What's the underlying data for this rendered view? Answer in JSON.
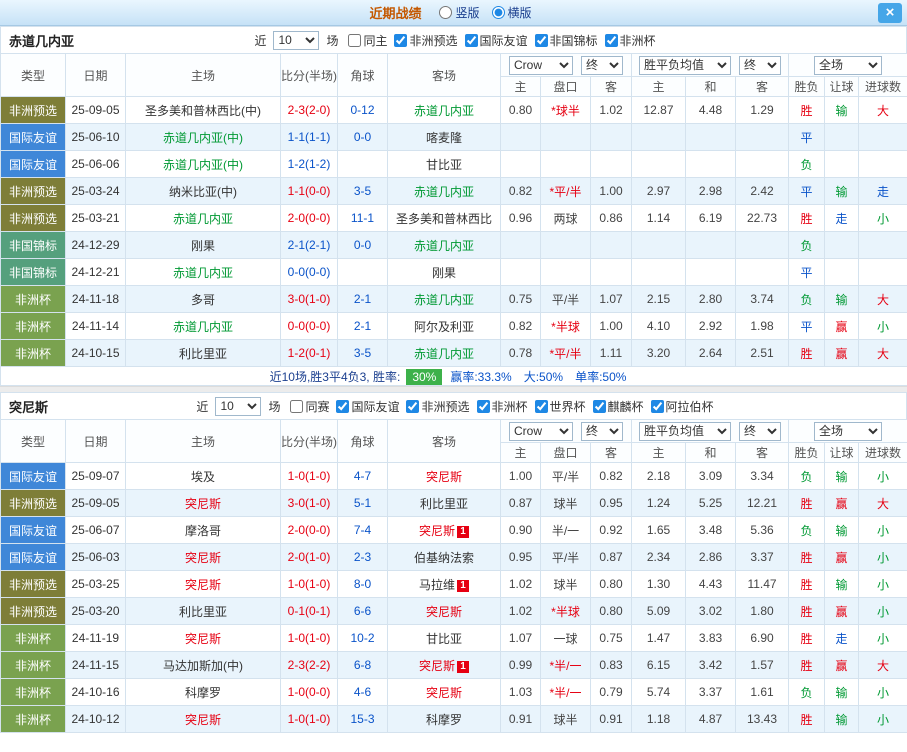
{
  "title_bar": {
    "title": "近期战绩",
    "vertical": "竖版",
    "horizontal": "横版",
    "close": "×"
  },
  "labels": {
    "near": "近",
    "games": "场"
  },
  "table_head": {
    "main": [
      "类型",
      "日期",
      "主场",
      "比分(半场)",
      "角球",
      "客场"
    ],
    "sub": [
      "主",
      "盘口",
      "客",
      "主",
      "和",
      "客",
      "胜负",
      "让球",
      "进球数"
    ]
  },
  "colors": {
    "red": "#e60012",
    "green": "#009933",
    "blue": "#0a53c9",
    "win_rate_badge": "#3db14a",
    "type": {
      "非洲预选": "#7e7e38",
      "国际友谊": "#3f87d8",
      "非国锦标": "#55a07d",
      "非洲杯": "#7aa24f"
    }
  },
  "sections": [
    {
      "team": "赤道几内亚",
      "focal_color": "#009933",
      "selects": {
        "count": "10",
        "book": "Crow",
        "book_state": "终",
        "avg": "胜平负均值",
        "avg_state": "终",
        "scope": "全场"
      },
      "filters": [
        {
          "label": "同主",
          "on": false
        },
        {
          "label": "非洲预选",
          "on": true
        },
        {
          "label": "国际友谊",
          "on": true
        },
        {
          "label": "非国锦标",
          "on": true
        },
        {
          "label": "非洲杯",
          "on": true
        }
      ],
      "rows": [
        {
          "ty": "非洲预选",
          "dt": "25-09-05",
          "hm": "圣多美和普林西比(中)",
          "hf": 0,
          "hr": 0,
          "sc": "2-3(2-0)",
          "sx": "r",
          "cn": "0-12",
          "aw": "赤道几内亚",
          "af": 1,
          "ar": 0,
          "od": [
            "0.80",
            "*球半",
            "1.02"
          ],
          "ox": "r",
          "av": [
            "12.87",
            "4.48",
            "1.29"
          ],
          "rs": [
            "胜",
            "r"
          ],
          "rq": [
            "输",
            "g"
          ],
          "gq": [
            "大",
            "r"
          ]
        },
        {
          "ty": "国际友谊",
          "dt": "25-06-10",
          "hm": "赤道几内亚(中)",
          "hf": 1,
          "hr": 0,
          "sc": "1-1(1-1)",
          "sx": "b",
          "cn": "0-0",
          "aw": "喀麦隆",
          "af": 0,
          "ar": 0,
          "od": [
            "",
            "",
            ""
          ],
          "ox": "",
          "av": [
            "",
            "",
            ""
          ],
          "rs": [
            "平",
            "b"
          ],
          "rq": [
            "",
            ""
          ],
          "gq": [
            "",
            ""
          ]
        },
        {
          "ty": "国际友谊",
          "dt": "25-06-06",
          "hm": "赤道几内亚(中)",
          "hf": 1,
          "hr": 0,
          "sc": "1-2(1-2)",
          "sx": "b",
          "cn": "",
          "aw": "甘比亚",
          "af": 0,
          "ar": 0,
          "od": [
            "",
            "",
            ""
          ],
          "ox": "",
          "av": [
            "",
            "",
            ""
          ],
          "rs": [
            "负",
            "g"
          ],
          "rq": [
            "",
            ""
          ],
          "gq": [
            "",
            ""
          ]
        },
        {
          "ty": "非洲预选",
          "dt": "25-03-24",
          "hm": "纳米比亚(中)",
          "hf": 0,
          "hr": 0,
          "sc": "1-1(0-0)",
          "sx": "r",
          "cn": "3-5",
          "aw": "赤道几内亚",
          "af": 1,
          "ar": 0,
          "od": [
            "0.82",
            "*平/半",
            "1.00"
          ],
          "ox": "r",
          "av": [
            "2.97",
            "2.98",
            "2.42"
          ],
          "rs": [
            "平",
            "b"
          ],
          "rq": [
            "输",
            "g"
          ],
          "gq": [
            "走",
            "b"
          ]
        },
        {
          "ty": "非洲预选",
          "dt": "25-03-21",
          "hm": "赤道几内亚",
          "hf": 1,
          "hr": 0,
          "sc": "2-0(0-0)",
          "sx": "r",
          "cn": "11-1",
          "aw": "圣多美和普林西比",
          "af": 0,
          "ar": 0,
          "od": [
            "0.96",
            "两球",
            "0.86"
          ],
          "ox": "",
          "av": [
            "1.14",
            "6.19",
            "22.73"
          ],
          "rs": [
            "胜",
            "r"
          ],
          "rq": [
            "走",
            "b"
          ],
          "gq": [
            "小",
            "g"
          ]
        },
        {
          "ty": "非国锦标",
          "dt": "24-12-29",
          "hm": "刚果",
          "hf": 0,
          "hr": 0,
          "sc": "2-1(2-1)",
          "sx": "b",
          "cn": "0-0",
          "aw": "赤道几内亚",
          "af": 1,
          "ar": 0,
          "od": [
            "",
            "",
            ""
          ],
          "ox": "",
          "av": [
            "",
            "",
            ""
          ],
          "rs": [
            "负",
            "g"
          ],
          "rq": [
            "",
            ""
          ],
          "gq": [
            "",
            ""
          ]
        },
        {
          "ty": "非国锦标",
          "dt": "24-12-21",
          "hm": "赤道几内亚",
          "hf": 1,
          "hr": 0,
          "sc": "0-0(0-0)",
          "sx": "b",
          "cn": "",
          "aw": "刚果",
          "af": 0,
          "ar": 0,
          "od": [
            "",
            "",
            ""
          ],
          "ox": "",
          "av": [
            "",
            "",
            ""
          ],
          "rs": [
            "平",
            "b"
          ],
          "rq": [
            "",
            ""
          ],
          "gq": [
            "",
            ""
          ]
        },
        {
          "ty": "非洲杯",
          "dt": "24-11-18",
          "hm": "多哥",
          "hf": 0,
          "hr": 0,
          "sc": "3-0(1-0)",
          "sx": "r",
          "cn": "2-1",
          "aw": "赤道几内亚",
          "af": 1,
          "ar": 0,
          "od": [
            "0.75",
            "平/半",
            "1.07"
          ],
          "ox": "",
          "av": [
            "2.15",
            "2.80",
            "3.74"
          ],
          "rs": [
            "负",
            "g"
          ],
          "rq": [
            "输",
            "g"
          ],
          "gq": [
            "大",
            "r"
          ]
        },
        {
          "ty": "非洲杯",
          "dt": "24-11-14",
          "hm": "赤道几内亚",
          "hf": 1,
          "hr": 0,
          "sc": "0-0(0-0)",
          "sx": "r",
          "cn": "2-1",
          "aw": "阿尔及利亚",
          "af": 0,
          "ar": 0,
          "od": [
            "0.82",
            "*半球",
            "1.00"
          ],
          "ox": "r",
          "av": [
            "4.10",
            "2.92",
            "1.98"
          ],
          "rs": [
            "平",
            "b"
          ],
          "rq": [
            "赢",
            "r"
          ],
          "gq": [
            "小",
            "g"
          ]
        },
        {
          "ty": "非洲杯",
          "dt": "24-10-15",
          "hm": "利比里亚",
          "hf": 0,
          "hr": 0,
          "sc": "1-2(0-1)",
          "sx": "r",
          "cn": "3-5",
          "aw": "赤道几内亚",
          "af": 1,
          "ar": 0,
          "od": [
            "0.78",
            "*平/半",
            "1.11"
          ],
          "ox": "r",
          "av": [
            "3.20",
            "2.64",
            "2.51"
          ],
          "rs": [
            "胜",
            "r"
          ],
          "rq": [
            "赢",
            "r"
          ],
          "gq": [
            "大",
            "r"
          ]
        }
      ],
      "footer": {
        "lead": "近10场,胜3平4负3, 胜率:",
        "rate": "30%",
        "stats": [
          "赢率:33.3%",
          "大:50%",
          "单率:50%"
        ]
      }
    },
    {
      "team": "突尼斯",
      "focal_color": "#e60012",
      "selects": {
        "count": "10",
        "book": "Crow",
        "book_state": "终",
        "avg": "胜平负均值",
        "avg_state": "终",
        "scope": "全场"
      },
      "filters": [
        {
          "label": "同赛",
          "on": false
        },
        {
          "label": "国际友谊",
          "on": true
        },
        {
          "label": "非洲预选",
          "on": true
        },
        {
          "label": "非洲杯",
          "on": true
        },
        {
          "label": "世界杯",
          "on": true
        },
        {
          "label": "麒麟杯",
          "on": true
        },
        {
          "label": "阿拉伯杯",
          "on": true
        }
      ],
      "rows": [
        {
          "ty": "国际友谊",
          "dt": "25-09-07",
          "hm": "埃及",
          "hf": 0,
          "hr": 0,
          "sc": "1-0(1-0)",
          "sx": "r",
          "cn": "4-7",
          "aw": "突尼斯",
          "af": 1,
          "ar": 0,
          "od": [
            "1.00",
            "平/半",
            "0.82"
          ],
          "ox": "",
          "av": [
            "2.18",
            "3.09",
            "3.34"
          ],
          "rs": [
            "负",
            "g"
          ],
          "rq": [
            "输",
            "g"
          ],
          "gq": [
            "小",
            "g"
          ]
        },
        {
          "ty": "非洲预选",
          "dt": "25-09-05",
          "hm": "突尼斯",
          "hf": 1,
          "hr": 0,
          "sc": "3-0(1-0)",
          "sx": "r",
          "cn": "5-1",
          "aw": "利比里亚",
          "af": 0,
          "ar": 0,
          "od": [
            "0.87",
            "球半",
            "0.95"
          ],
          "ox": "",
          "av": [
            "1.24",
            "5.25",
            "12.21"
          ],
          "rs": [
            "胜",
            "r"
          ],
          "rq": [
            "赢",
            "r"
          ],
          "gq": [
            "大",
            "r"
          ]
        },
        {
          "ty": "国际友谊",
          "dt": "25-06-07",
          "hm": "摩洛哥",
          "hf": 0,
          "hr": 0,
          "sc": "2-0(0-0)",
          "sx": "r",
          "cn": "7-4",
          "aw": "突尼斯",
          "af": 1,
          "ar": 1,
          "od": [
            "0.90",
            "半/一",
            "0.92"
          ],
          "ox": "",
          "av": [
            "1.65",
            "3.48",
            "5.36"
          ],
          "rs": [
            "负",
            "g"
          ],
          "rq": [
            "输",
            "g"
          ],
          "gq": [
            "小",
            "g"
          ]
        },
        {
          "ty": "国际友谊",
          "dt": "25-06-03",
          "hm": "突尼斯",
          "hf": 1,
          "hr": 0,
          "sc": "2-0(1-0)",
          "sx": "r",
          "cn": "2-3",
          "aw": "伯基纳法索",
          "af": 0,
          "ar": 0,
          "od": [
            "0.95",
            "平/半",
            "0.87"
          ],
          "ox": "",
          "av": [
            "2.34",
            "2.86",
            "3.37"
          ],
          "rs": [
            "胜",
            "r"
          ],
          "rq": [
            "赢",
            "r"
          ],
          "gq": [
            "小",
            "g"
          ]
        },
        {
          "ty": "非洲预选",
          "dt": "25-03-25",
          "hm": "突尼斯",
          "hf": 1,
          "hr": 0,
          "sc": "1-0(1-0)",
          "sx": "r",
          "cn": "8-0",
          "aw": "马拉维",
          "af": 0,
          "ar": 1,
          "od": [
            "1.02",
            "球半",
            "0.80"
          ],
          "ox": "",
          "av": [
            "1.30",
            "4.43",
            "11.47"
          ],
          "rs": [
            "胜",
            "r"
          ],
          "rq": [
            "输",
            "g"
          ],
          "gq": [
            "小",
            "g"
          ]
        },
        {
          "ty": "非洲预选",
          "dt": "25-03-20",
          "hm": "利比里亚",
          "hf": 0,
          "hr": 0,
          "sc": "0-1(0-1)",
          "sx": "r",
          "cn": "6-6",
          "aw": "突尼斯",
          "af": 1,
          "ar": 0,
          "od": [
            "1.02",
            "*半球",
            "0.80"
          ],
          "ox": "r",
          "av": [
            "5.09",
            "3.02",
            "1.80"
          ],
          "rs": [
            "胜",
            "r"
          ],
          "rq": [
            "赢",
            "r"
          ],
          "gq": [
            "小",
            "g"
          ]
        },
        {
          "ty": "非洲杯",
          "dt": "24-11-19",
          "hm": "突尼斯",
          "hf": 1,
          "hr": 0,
          "sc": "1-0(1-0)",
          "sx": "r",
          "cn": "10-2",
          "aw": "甘比亚",
          "af": 0,
          "ar": 0,
          "od": [
            "1.07",
            "一球",
            "0.75"
          ],
          "ox": "",
          "av": [
            "1.47",
            "3.83",
            "6.90"
          ],
          "rs": [
            "胜",
            "r"
          ],
          "rq": [
            "走",
            "b"
          ],
          "gq": [
            "小",
            "g"
          ]
        },
        {
          "ty": "非洲杯",
          "dt": "24-11-15",
          "hm": "马达加斯加(中)",
          "hf": 0,
          "hr": 0,
          "sc": "2-3(2-2)",
          "sx": "r",
          "cn": "6-8",
          "aw": "突尼斯",
          "af": 1,
          "ar": 1,
          "od": [
            "0.99",
            "*半/一",
            "0.83"
          ],
          "ox": "r",
          "av": [
            "6.15",
            "3.42",
            "1.57"
          ],
          "rs": [
            "胜",
            "r"
          ],
          "rq": [
            "赢",
            "r"
          ],
          "gq": [
            "大",
            "r"
          ]
        },
        {
          "ty": "非洲杯",
          "dt": "24-10-16",
          "hm": "科摩罗",
          "hf": 0,
          "hr": 0,
          "sc": "1-0(0-0)",
          "sx": "r",
          "cn": "4-6",
          "aw": "突尼斯",
          "af": 1,
          "ar": 0,
          "od": [
            "1.03",
            "*半/一",
            "0.79"
          ],
          "ox": "r",
          "av": [
            "5.74",
            "3.37",
            "1.61"
          ],
          "rs": [
            "负",
            "g"
          ],
          "rq": [
            "输",
            "g"
          ],
          "gq": [
            "小",
            "g"
          ]
        },
        {
          "ty": "非洲杯",
          "dt": "24-10-12",
          "hm": "突尼斯",
          "hf": 1,
          "hr": 0,
          "sc": "1-0(1-0)",
          "sx": "r",
          "cn": "15-3",
          "aw": "科摩罗",
          "af": 0,
          "ar": 0,
          "od": [
            "0.91",
            "球半",
            "0.91"
          ],
          "ox": "",
          "av": [
            "1.18",
            "4.87",
            "13.43"
          ],
          "rs": [
            "胜",
            "r"
          ],
          "rq": [
            "输",
            "g"
          ],
          "gq": [
            "小",
            "g"
          ]
        }
      ],
      "footer": null
    }
  ]
}
